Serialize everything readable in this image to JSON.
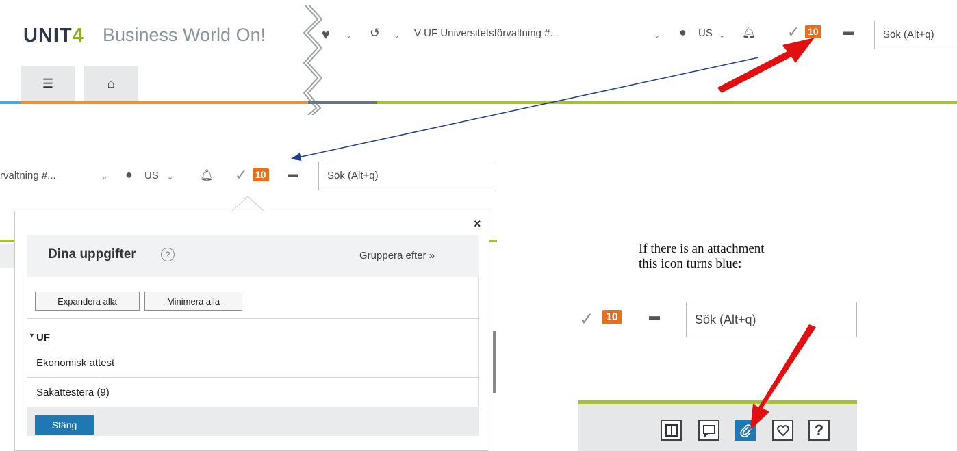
{
  "header": {
    "brand": "UNIT",
    "brand_digit": "4",
    "product": "Business World On!",
    "company": "V UF Universitetsförvaltning #...",
    "user": "US",
    "task_count": "10",
    "search_placeholder": "Sök (Alt+q)"
  },
  "zoomed_header": {
    "company_trunc": "rvaltning #...",
    "user": "US",
    "task_count": "10",
    "search_placeholder": "Sök (Alt+q)"
  },
  "tasks_popup": {
    "title": "Dina uppgifter",
    "group_by": "Gruppera efter",
    "expand_all": "Expandera alla",
    "collapse_all": "Minimera alla",
    "group_name": "UF",
    "items": [
      "Ekonomisk attest",
      "Sakattestera (9)"
    ],
    "close_label": "Stäng"
  },
  "caption": {
    "line1": "If there is an attachment",
    "line2": "this icon turns blue:"
  },
  "side_header": {
    "task_count": "10",
    "search_placeholder": "Sök (Alt+q)"
  },
  "colors": {
    "accent_blue": "#1e78b4",
    "badge_orange": "#e8701a",
    "stripe_green": "#a6c03a",
    "stripe_orange": "#e8933a",
    "annotation_red": "#e01010"
  }
}
